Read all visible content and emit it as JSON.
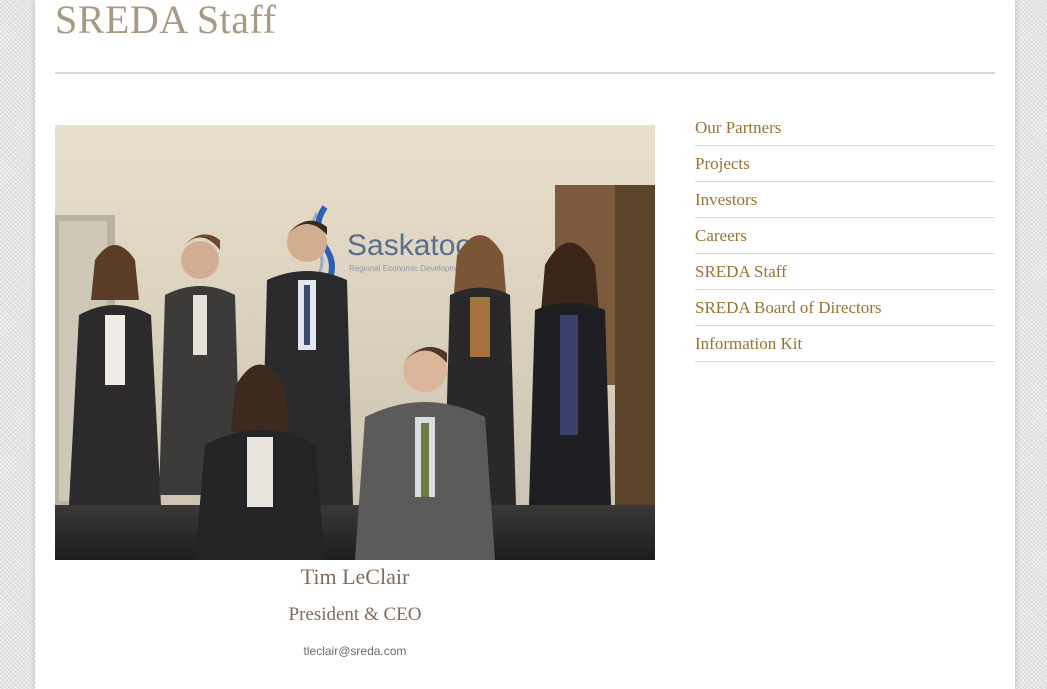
{
  "page": {
    "title": "SREDA Staff"
  },
  "photo": {
    "sign_text": "Saskatoon",
    "sign_subtext": "Regional Economic Development Authority"
  },
  "staff": {
    "name": "Tim LeClair",
    "position": "President & CEO",
    "email": "tleclair@sreda.com"
  },
  "sidebar": {
    "items": [
      {
        "label": "Our Partners"
      },
      {
        "label": "Projects"
      },
      {
        "label": "Investors"
      },
      {
        "label": "Careers"
      },
      {
        "label": "SREDA Staff"
      },
      {
        "label": "SREDA Board of Directors"
      },
      {
        "label": "Information Kit"
      }
    ]
  },
  "colors": {
    "title": "#a89984",
    "link": "#9a7331",
    "caption": "#7e6d5e"
  }
}
